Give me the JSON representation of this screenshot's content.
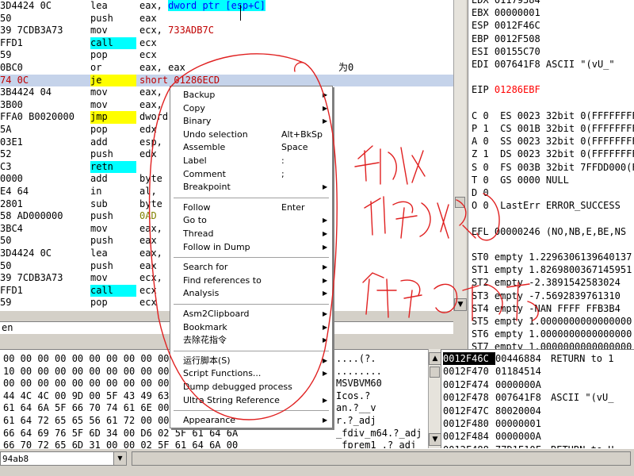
{
  "disasm": {
    "rows": [
      {
        "hex": "3D4424 0C",
        "mn": "lea",
        "op": "eax, ",
        "op_hl": "dword ptr [esp+C]",
        "cm": ""
      },
      {
        "hex": "50",
        "mn": "push",
        "op": "eax",
        "cm": ""
      },
      {
        "hex": "39 7CDB3A73",
        "mn": "mov",
        "op": "ecx, ",
        "op_red": "733ADB7C",
        "cm": ""
      },
      {
        "hex": "FFD1",
        "mn": "call",
        "op": "ecx",
        "cm": ""
      },
      {
        "hex": "59",
        "mn": "pop",
        "op": "ecx",
        "cm": ""
      },
      {
        "hex": "0BC0",
        "mn": "or",
        "op": "eax, eax",
        "cm": "为0"
      },
      {
        "hex": "74 0C",
        "mn": "je",
        "op": "short 01286ECD",
        "cm": ""
      },
      {
        "hex": "3B4424 04",
        "mn": "mov",
        "op": "eax,",
        "cm": ""
      },
      {
        "hex": "3B00",
        "mn": "mov",
        "op": "eax,",
        "cm": ""
      },
      {
        "hex": "FFA0 B0020000",
        "mn": "jmp",
        "op": "dword",
        "cm": ""
      },
      {
        "hex": "5A",
        "mn": "pop",
        "op": "edx",
        "cm": ""
      },
      {
        "hex": "03E1",
        "mn": "add",
        "op": "esp,",
        "cm": ""
      },
      {
        "hex": "52",
        "mn": "push",
        "op": "edx",
        "cm": ""
      },
      {
        "hex": "C3",
        "mn": "retn",
        "op": "",
        "cm": ""
      },
      {
        "hex": "0000",
        "mn": "add",
        "op": "byte",
        "cm": ""
      },
      {
        "hex": "E4 64",
        "mn": "in",
        "op": "al, ",
        "cm": ""
      },
      {
        "hex": "2801",
        "mn": "sub",
        "op": "byte",
        "cm": ""
      },
      {
        "hex": "58 AD000000",
        "mn": "push",
        "op": "0AD",
        "cm": ""
      },
      {
        "hex": "3BC4",
        "mn": "mov",
        "op": "eax,",
        "cm": ""
      },
      {
        "hex": "50",
        "mn": "push",
        "op": "eax",
        "cm": ""
      },
      {
        "hex": "3D4424 0C",
        "mn": "lea",
        "op": "eax,",
        "cm": ""
      },
      {
        "hex": "50",
        "mn": "push",
        "op": "eax",
        "cm": ""
      },
      {
        "hex": "39 7CDB3A73",
        "mn": "mov",
        "op": "ecx,",
        "cm": ""
      },
      {
        "hex": "FFD1",
        "mn": "call",
        "op": "ecx",
        "cm": ""
      },
      {
        "hex": "59",
        "mn": "pop",
        "op": "ecx",
        "cm": ""
      },
      {
        "hex": "0BC0",
        "mn": "or",
        "op": "eax",
        "cm": ""
      }
    ],
    "info_line": "en"
  },
  "registers": [
    {
      "text": "EDX 01179384"
    },
    {
      "text": "EBX 00000001"
    },
    {
      "text": "ESP 0012F46C"
    },
    {
      "text": "EBP 0012F508"
    },
    {
      "text": "ESI 00155C70"
    },
    {
      "text": "EDI 007641F8 ASCII \"(vU_\""
    },
    {
      "text": ""
    },
    {
      "text": "EIP ",
      "red": "01286EBF"
    },
    {
      "text": ""
    },
    {
      "text": "C 0  ES 0023 32bit 0(FFFFFFFF)"
    },
    {
      "text": "P 1  CS 001B 32bit 0(FFFFFFFF)"
    },
    {
      "text": "A 0  SS 0023 32bit 0(FFFFFFFF)"
    },
    {
      "text": "Z 1  DS 0023 32bit 0(FFFFFFFF)"
    },
    {
      "text": "S 0  FS 003B 32bit 7FFDD000(FFF)"
    },
    {
      "text": "T 0  GS 0000 NULL"
    },
    {
      "text": "D 0"
    },
    {
      "text": "O 0  LastErr ERROR_SUCCESS"
    },
    {
      "text": ""
    },
    {
      "text": "EFL 00000246 (NO,NB,E,BE,NS"
    },
    {
      "text": ""
    },
    {
      "text": "ST0 empty 1.2296306139640137"
    },
    {
      "text": "ST1 empty 1.8269800367145951"
    },
    {
      "text": "ST2 empty -2.3891542583024"
    },
    {
      "text": "ST3 empty -7.5692839761310"
    },
    {
      "text": "ST4 empty -NAN FFFF FFB3B4"
    },
    {
      "text": "ST5 empty 1.0000000000000000"
    },
    {
      "text": "ST6 empty 1.0000000000000000"
    },
    {
      "text": "ST7 empty 1.0000000000000000"
    },
    {
      "text": "              3 2 1 0"
    },
    {
      "text": "FST 4020  Cond 1 0 0 0  Err"
    }
  ],
  "dump": [
    {
      "hex": "00 00 00 00 00 00 00 00 00 00 00 00 00 00",
      "ascii": "....(?."
    },
    {
      "hex": "10 00 00 00 00 00 00 00 00 00 00 00 00 00",
      "ascii": "........"
    },
    {
      "hex": "00 00 00 00 00 00 00 00 00 00 4D 53 56 42",
      "ascii": "MSVBVM60"
    },
    {
      "hex": "44 4C 4C 00 9D 00 5F 43 49 63 6F 73 00 00",
      "ascii": "Icos.?"
    },
    {
      "hex": "61 64 6A 5F 66 70 74 61 6E 00 00 00 00 00",
      "ascii": "an.?__v"
    },
    {
      "hex": "61 64 72 65 65 56 61 72 00 00 00 00 00 00",
      "ascii": "r.?_adj"
    },
    {
      "hex": "66 64 69 76 5F 6D 34 00 D6 02 5F 61 64 6A",
      "ascii": "_fdiv_m64.?_adj"
    },
    {
      "hex": "66 70 72 65 6D 31 00 00 02 5F 61 64 6A 00",
      "ascii": "_fprem1 .?_adj"
    }
  ],
  "stack": [
    {
      "addr": "0012F46C",
      "val": "00446884",
      "cm": "RETURN to 1"
    },
    {
      "addr": "0012F470",
      "val": "01184514",
      "cm": ""
    },
    {
      "addr": "0012F474",
      "val": "0000000A",
      "cm": ""
    },
    {
      "addr": "0012F478",
      "val": "007641F8",
      "cm": "ASCII \"(vU_"
    },
    {
      "addr": "0012F47C",
      "val": "80020004",
      "cm": ""
    },
    {
      "addr": "0012F480",
      "val": "00000001",
      "cm": ""
    },
    {
      "addr": "0012F484",
      "val": "0000000A",
      "cm": ""
    },
    {
      "addr": "0012F488",
      "val": "77D1E10F",
      "cm": "RETURN to U"
    }
  ],
  "command": {
    "value": "94ab8"
  },
  "menu": [
    {
      "label": "Backup",
      "short": "",
      "arrow": true
    },
    {
      "label": "Copy",
      "short": "",
      "arrow": true
    },
    {
      "label": "Binary",
      "short": "",
      "arrow": true
    },
    {
      "label": "Undo selection",
      "short": "Alt+BkSp",
      "arrow": false
    },
    {
      "label": "Assemble",
      "short": "Space",
      "arrow": false
    },
    {
      "label": "Label",
      "short": ":",
      "arrow": false
    },
    {
      "label": "Comment",
      "short": ";",
      "arrow": false
    },
    {
      "label": "Breakpoint",
      "short": "",
      "arrow": true
    },
    {
      "sep": true
    },
    {
      "label": "Follow",
      "short": "Enter",
      "arrow": false
    },
    {
      "label": "Go to",
      "short": "",
      "arrow": true
    },
    {
      "label": "Thread",
      "short": "",
      "arrow": true
    },
    {
      "label": "Follow in Dump",
      "short": "",
      "arrow": true
    },
    {
      "sep": true
    },
    {
      "label": "Search for",
      "short": "",
      "arrow": true
    },
    {
      "label": "Find references to",
      "short": "",
      "arrow": true
    },
    {
      "label": "Analysis",
      "short": "",
      "arrow": true
    },
    {
      "sep": true
    },
    {
      "label": "Asm2Clipboard",
      "short": "",
      "arrow": true
    },
    {
      "label": "Bookmark",
      "short": "",
      "arrow": true
    },
    {
      "label": "去除花指令",
      "short": "",
      "arrow": true
    },
    {
      "sep": true
    },
    {
      "label": "运行脚本(S)",
      "short": "",
      "arrow": true
    },
    {
      "label": "Script Functions...",
      "short": "",
      "arrow": true
    },
    {
      "label": "Dump debugged process",
      "short": "",
      "arrow": false
    },
    {
      "label": "Ultra String Reference",
      "short": "",
      "arrow": true
    },
    {
      "sep": true
    },
    {
      "label": "Appearance",
      "short": "",
      "arrow": true
    }
  ],
  "icons": {
    "submenu_arrow": "▶",
    "scroll_up": "▲",
    "scroll_down": "▼",
    "dropdown": "▼"
  }
}
